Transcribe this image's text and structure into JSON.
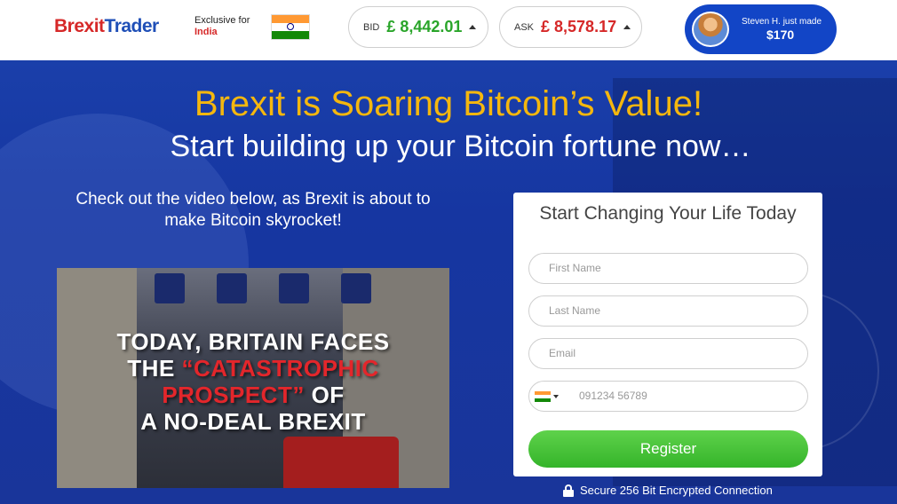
{
  "header": {
    "logo_part1": "Brexit",
    "logo_part2": "Trader",
    "exclusive_label": "Exclusive for",
    "exclusive_country": "India",
    "bid": {
      "label": "BID",
      "value": "£ 8,442.01"
    },
    "ask": {
      "label": "ASK",
      "value": "£ 8,578.17"
    },
    "notification": {
      "text": "Steven H. just made",
      "amount": "$170"
    }
  },
  "hero": {
    "headline": "Brexit is Soaring Bitcoin’s Value!",
    "subheadline": "Start building up your Bitcoin fortune now…",
    "intro_line1": "Check out the video below, as Brexit is about to",
    "intro_line2": "make Bitcoin skyrocket!",
    "video_caption": {
      "line1": "TODAY, BRITAIN FACES",
      "line2_white": "THE ",
      "line2_red": "“CATASTROPHIC",
      "line3_red": "PROSPECT”",
      "line3_white": " OF",
      "line4": "A NO-DEAL BREXIT"
    }
  },
  "form": {
    "title": "Start Changing Your Life Today",
    "first_name_placeholder": "First Name",
    "last_name_placeholder": "Last Name",
    "email_placeholder": "Email",
    "phone_placeholder": "091234 56789",
    "register_label": "Register",
    "secure_text": "Secure 256 Bit Encrypted Connection"
  },
  "colors": {
    "brand_red": "#d62828",
    "brand_blue": "#1f4fb7",
    "headline_gold": "#f5b70e",
    "register_green": "#3bbb30"
  }
}
